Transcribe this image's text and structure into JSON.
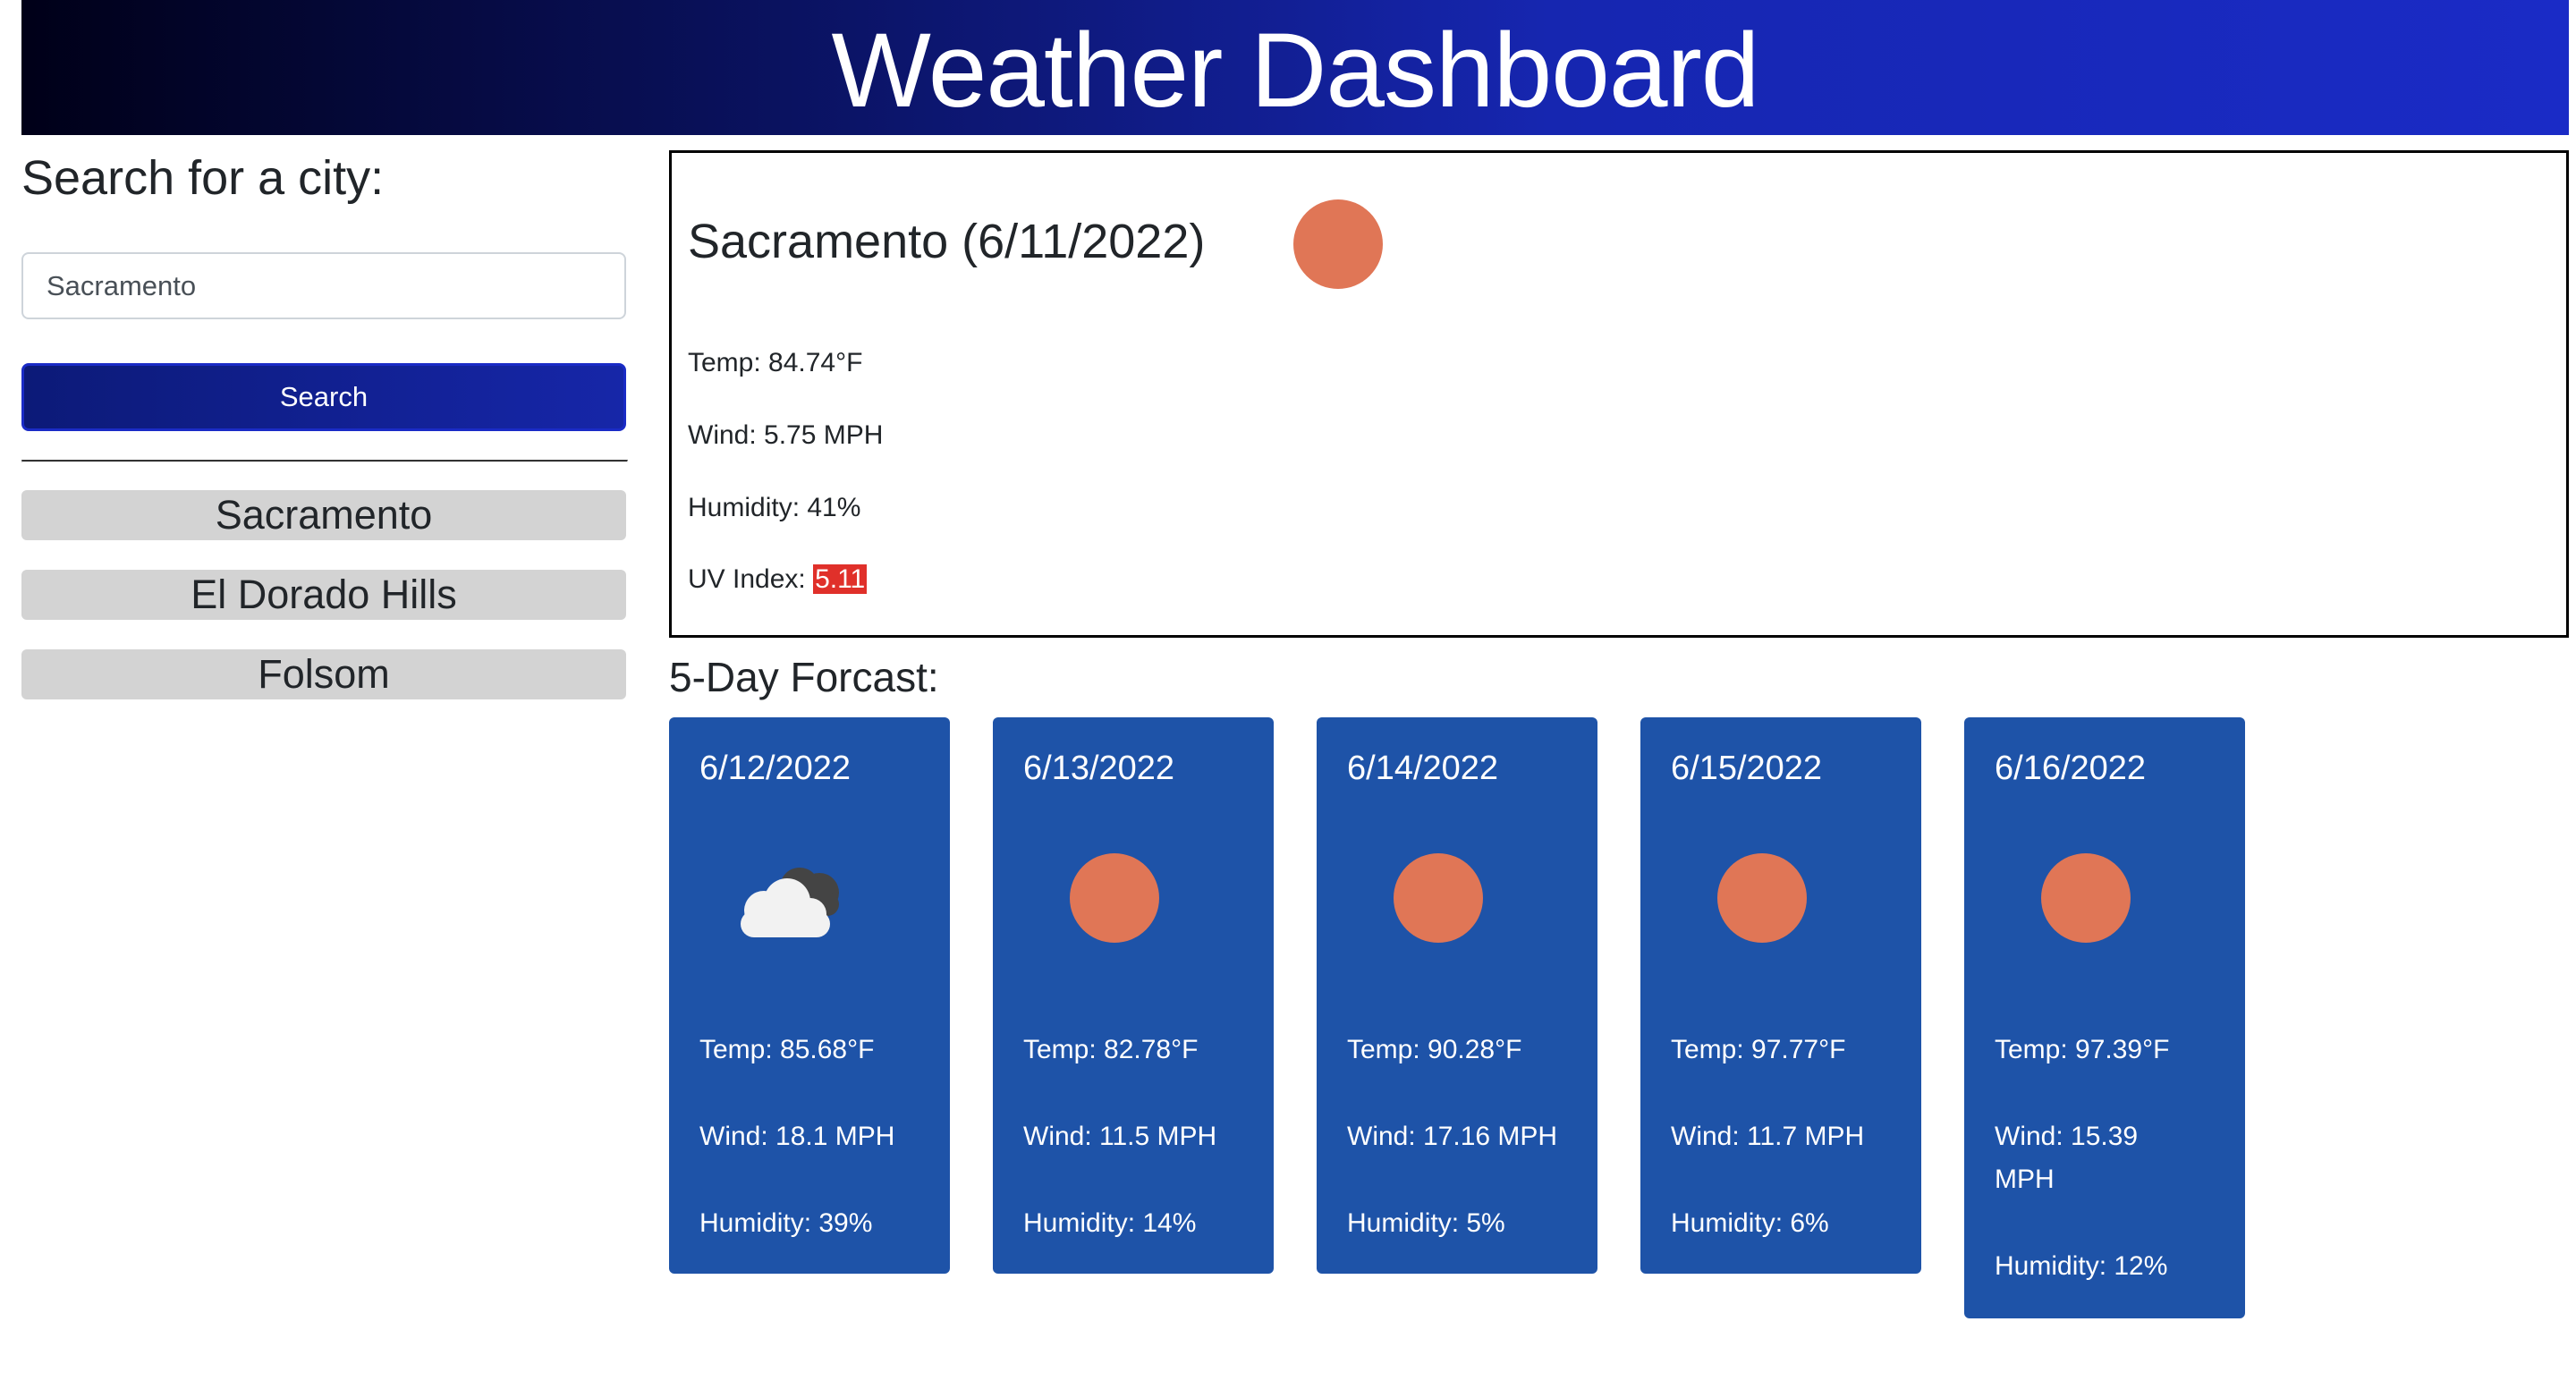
{
  "header": {
    "title": "Weather Dashboard"
  },
  "sidebar": {
    "heading": "Search for a city:",
    "search": {
      "value": "Sacramento",
      "placeholder": "Sacramento"
    },
    "search_button": "Search",
    "history": [
      "Sacramento",
      "El Dorado Hills",
      "Folsom"
    ]
  },
  "current": {
    "title": "Sacramento (6/11/2022)",
    "icon": "sun-icon",
    "temp": "Temp: 84.74°F",
    "wind": "Wind: 5.75 MPH",
    "humidity": "Humidity: 41%",
    "uv_label": "UV Index: ",
    "uv_value": "5.11",
    "uv_color": "#e0302a"
  },
  "forecast": {
    "heading": "5-Day Forcast:",
    "days": [
      {
        "date": "6/12/2022",
        "icon": "cloud-icon",
        "temp": "Temp: 85.68°F",
        "wind": "Wind: 18.1 MPH",
        "humidity": "Humidity: 39%"
      },
      {
        "date": "6/13/2022",
        "icon": "sun-icon",
        "temp": "Temp: 82.78°F",
        "wind": "Wind: 11.5 MPH",
        "humidity": "Humidity: 14%"
      },
      {
        "date": "6/14/2022",
        "icon": "sun-icon",
        "temp": "Temp: 90.28°F",
        "wind": "Wind: 17.16 MPH",
        "humidity": "Humidity: 5%"
      },
      {
        "date": "6/15/2022",
        "icon": "sun-icon",
        "temp": "Temp: 97.77°F",
        "wind": "Wind: 11.7 MPH",
        "humidity": "Humidity: 6%"
      },
      {
        "date": "6/16/2022",
        "icon": "sun-icon",
        "temp": "Temp: 97.39°F",
        "wind": "Wind: 15.39 MPH",
        "humidity": "Humidity: 12%"
      }
    ]
  },
  "colors": {
    "header_start": "#000018",
    "header_end": "#1a2bc6",
    "card": "#1e53a8",
    "sun": "#e07656"
  }
}
